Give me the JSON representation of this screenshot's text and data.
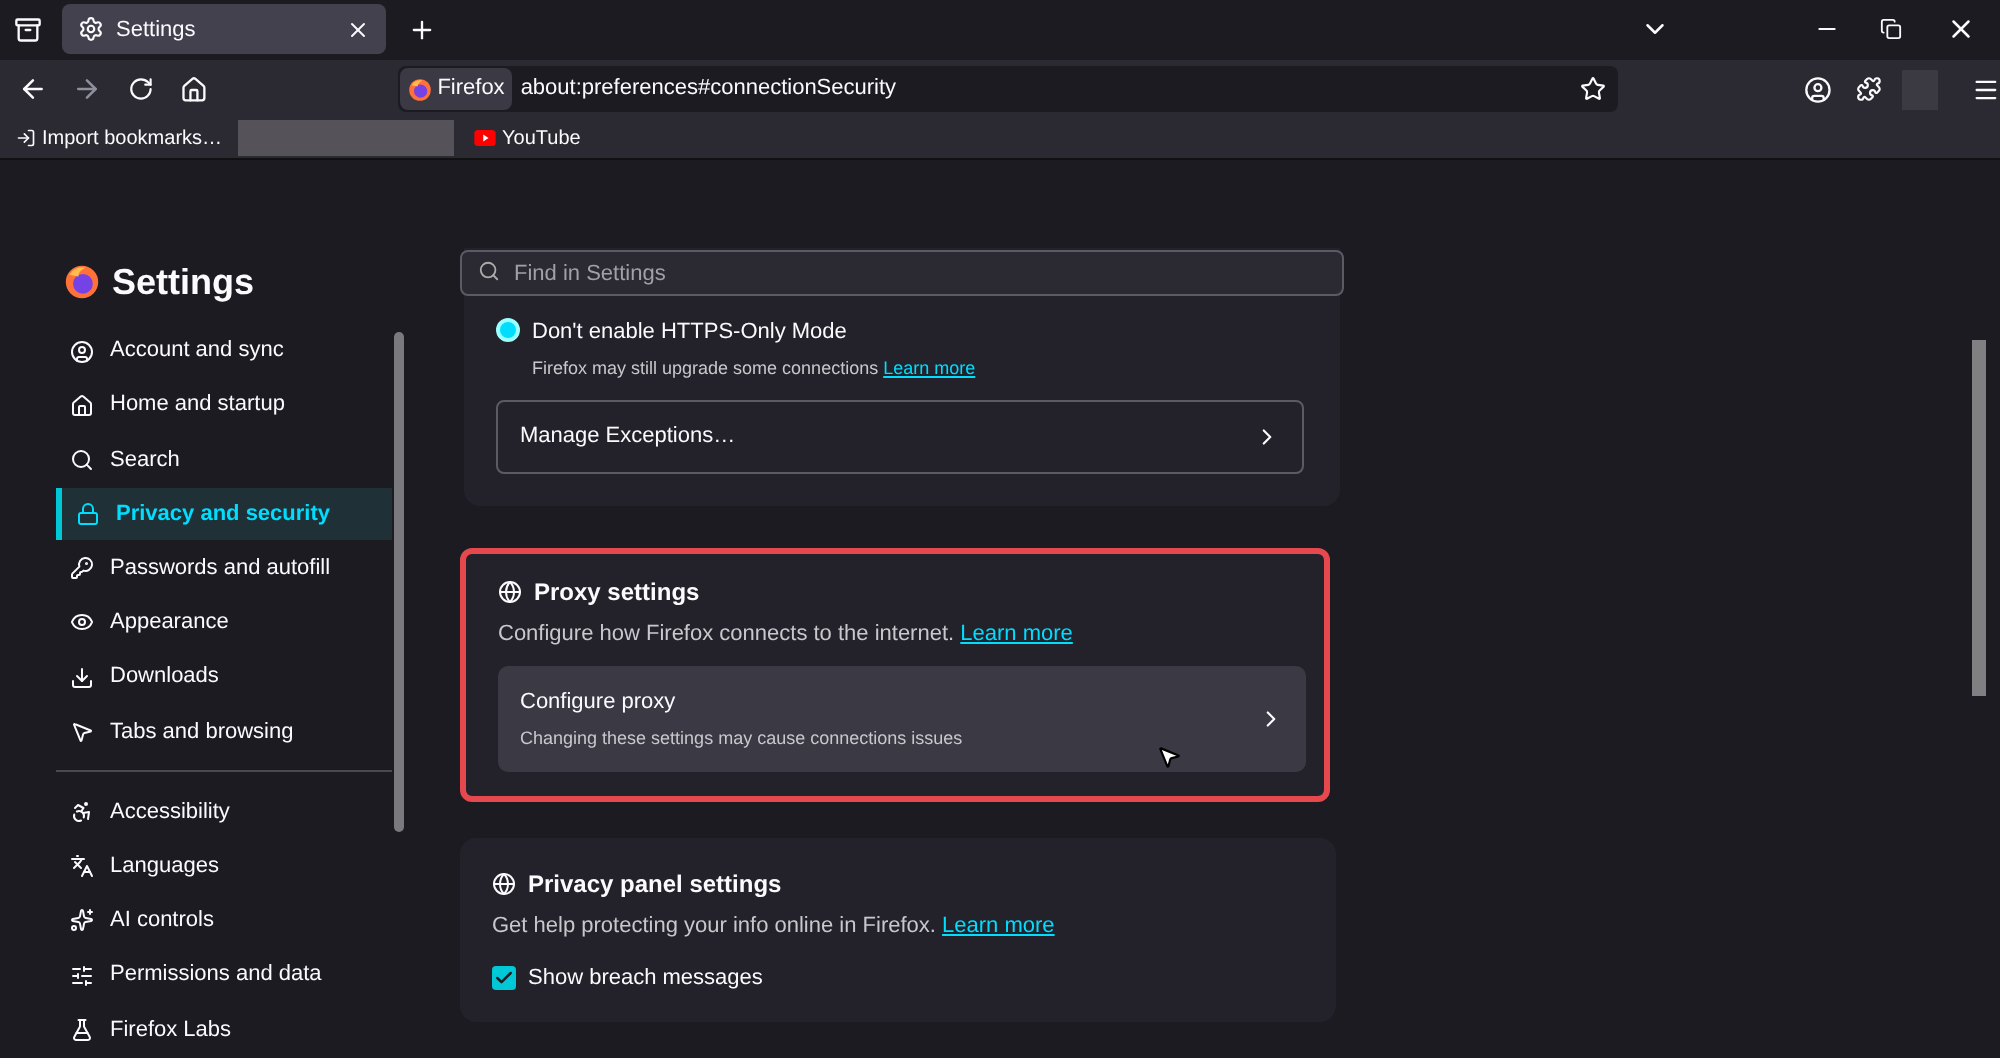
{
  "tabs": [
    {
      "title": "Settings",
      "selected": true
    }
  ],
  "address_bar": {
    "identity": "Firefox",
    "url": "about:preferences#connectionSecurity"
  },
  "bookmarks": [
    {
      "label": "Import bookmarks…"
    },
    {
      "label": "YouTube"
    }
  ],
  "sidebar": {
    "title": "Settings",
    "groups": [
      [
        {
          "label": "Account and sync",
          "selected": false
        },
        {
          "label": "Home and startup",
          "selected": false
        },
        {
          "label": "Search",
          "selected": false
        },
        {
          "label": "Privacy and security",
          "selected": true
        },
        {
          "label": "Passwords and autofill",
          "selected": false
        },
        {
          "label": "Appearance",
          "selected": false
        },
        {
          "label": "Downloads",
          "selected": false
        },
        {
          "label": "Tabs and browsing",
          "selected": false
        }
      ],
      [
        {
          "label": "Accessibility",
          "selected": false
        },
        {
          "label": "Languages",
          "selected": false
        },
        {
          "label": "AI controls",
          "selected": false
        },
        {
          "label": "Permissions and data",
          "selected": false
        },
        {
          "label": "Firefox Labs",
          "selected": false
        }
      ]
    ]
  },
  "search": {
    "placeholder": "Find in Settings"
  },
  "https_card": {
    "options": [
      {
        "label": "Don't enable HTTPS-Only Mode",
        "description": "Firefox may still upgrade some connections",
        "link": "Learn more",
        "selected": true
      }
    ],
    "button": "Manage Exceptions…"
  },
  "proxy_card": {
    "title": "Proxy settings",
    "description": "Configure how Firefox connects to the internet.",
    "link": "Learn more",
    "highlighted": true,
    "button": {
      "label": "Configure proxy",
      "description": "Changing these settings may cause connections issues"
    }
  },
  "privacy_panel_card": {
    "title": "Privacy panel settings",
    "description": "Get help protecting your info online in Firefox.",
    "link": "Learn more",
    "checkboxes": [
      {
        "label": "Show breach messages",
        "checked": true
      }
    ]
  }
}
